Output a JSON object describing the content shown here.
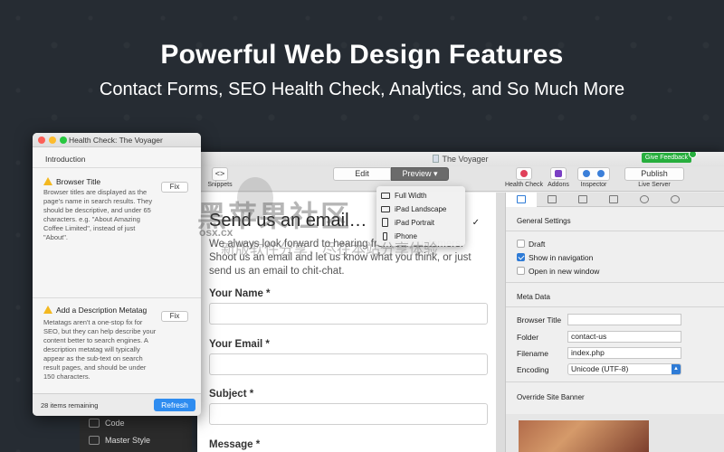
{
  "hero": {
    "title": "Powerful Web Design Features",
    "subtitle": "Contact Forms, SEO Health Check, Analytics, and So Much More"
  },
  "app": {
    "window_title": "The Voyager",
    "give_feedback": "Give Feedback",
    "toolbar": {
      "snippets_label": "Snippets",
      "snippets_glyph": "<>",
      "edit_label": "Edit",
      "preview_label": "Preview",
      "preview_caret": "▾",
      "health_check_label": "Health Check",
      "addons_label": "Addons",
      "inspector_label": "Inspector",
      "publish_label": "Publish",
      "live_server_label": "Live Server"
    },
    "preview_menu": {
      "items": [
        "Full Width",
        "iPad Landscape",
        "iPad Portrait",
        "iPhone"
      ],
      "selected_index": 2,
      "check": "✓"
    }
  },
  "page": {
    "heading": "Send us an email…",
    "intro": "We always look forward to hearing from our customers. Shoot us an email and let us know what you think, or just send us an email to chit-chat.",
    "fields": {
      "name": "Your Name *",
      "email": "Your Email *",
      "subject": "Subject *",
      "message": "Message *"
    }
  },
  "inspector": {
    "general_settings": "General Settings",
    "draft_label": "Draft",
    "draft_checked": false,
    "show_nav_label": "Show in navigation",
    "show_nav_checked": true,
    "new_window_label": "Open in new window",
    "new_window_checked": false,
    "meta_data": "Meta Data",
    "browser_title_label": "Browser Title",
    "browser_title_value": "",
    "folder_label": "Folder",
    "folder_value": "contact-us",
    "filename_label": "Filename",
    "filename_value": "index.php",
    "encoding_label": "Encoding",
    "encoding_value": "Unicode (UTF-8)",
    "override_banner": "Override Site Banner"
  },
  "health_check": {
    "title": "Health Check: The Voyager",
    "intro": "Introduction",
    "items": [
      {
        "title": "Browser Title",
        "description": "Browser titles are displayed as the page's name in search results. They should be descriptive, and under 65 characters. e.g. \"About Amazing Coffee Limited\", instead of just \"About\".",
        "fix": "Fix"
      },
      {
        "title": "Add a Description Metatag",
        "description": "Metatags aren't a one-stop fix for SEO, but they can help describe your content better to search engines. A description metatag will typically appear as the sub-text on search result pages, and should be under 150 characters.",
        "fix": "Fix"
      }
    ],
    "remaining": "28 items remaining",
    "refresh": "Refresh"
  },
  "sidebar": {
    "items": [
      "Code",
      "Master Style"
    ]
  },
  "watermark": {
    "big": "黑苹果社区",
    "small": "新版软件分享，尽在本站分享体验",
    "site": "osx.cx"
  },
  "colors": {
    "background": "#262c33",
    "accent_blue": "#2e8cf0",
    "feedback_green": "#27ae3d",
    "warning_yellow": "#f3b820"
  }
}
